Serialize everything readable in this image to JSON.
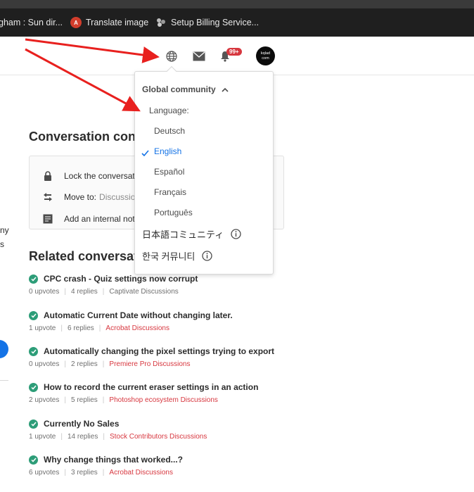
{
  "browser": {
    "bookmarks": [
      {
        "label": "gham : Sun dir..."
      },
      {
        "label": "Translate image",
        "icon": "translate-icon"
      },
      {
        "label": "Setup Billing Service...",
        "icon": "cluster-icon"
      }
    ]
  },
  "header": {
    "icons": [
      "globe-icon",
      "mail-icon",
      "bell-icon"
    ],
    "notification_badge": "99+",
    "avatar_line1": "kqlad",
    "avatar_line2": "com"
  },
  "dropdown": {
    "heading": "Global community",
    "language_label": "Language:",
    "languages": [
      "Deutsch",
      "English",
      "Español",
      "Français",
      "Português"
    ],
    "selected_language": "English",
    "communities": [
      "日本語コミュニティ",
      "한국 커뮤니티"
    ]
  },
  "conversation_controls": {
    "title": "Conversation cont",
    "lock_label": "Lock the conversatio",
    "move_label": "Move to:",
    "move_value": "Discussio",
    "note_label": "Add an internal note"
  },
  "left_fragments": [
    "ny",
    "s"
  ],
  "related": {
    "title": "Related conversat",
    "items": [
      {
        "title": "CPC crash - Quiz settings now corrupt",
        "upvotes": "0 upvotes",
        "replies": "4 replies",
        "board": "Captivate Discussions",
        "board_color": "#707070"
      },
      {
        "title": "Automatic Current Date without changing later.",
        "upvotes": "1 upvote",
        "replies": "6 replies",
        "board": "Acrobat Discussions",
        "board_color": "#d7373f"
      },
      {
        "title": "Automatically changing the pixel settings trying to export",
        "upvotes": "0 upvotes",
        "replies": "2 replies",
        "board": "Premiere Pro Discussions",
        "board_color": "#d7373f"
      },
      {
        "title": "How to record the current eraser settings in an action",
        "upvotes": "2 upvotes",
        "replies": "5 replies",
        "board": "Photoshop ecosystem Discussions",
        "board_color": "#d7373f"
      },
      {
        "title": "Currently No Sales",
        "upvotes": "1 upvote",
        "replies": "14 replies",
        "board": "Stock Contributors Discussions",
        "board_color": "#d7373f"
      },
      {
        "title": "Why change things that worked...?",
        "upvotes": "6 upvotes",
        "replies": "3 replies",
        "board": "Acrobat Discussions",
        "board_color": "#d7373f"
      }
    ]
  },
  "colors": {
    "accent": "#1473e6",
    "annotation_arrow": "#e8201e",
    "check_green": "#2d9d78",
    "link_red": "#d7373f"
  }
}
